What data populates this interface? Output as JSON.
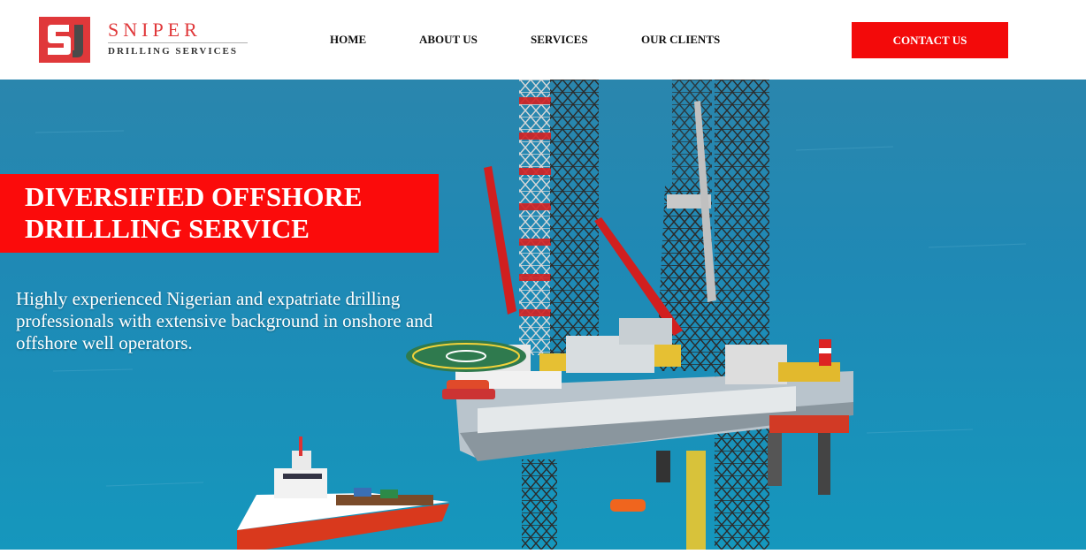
{
  "brand": {
    "name": "SNIPER",
    "tagline": "DRILLING SERVICES",
    "logo_icon": "sd-monogram-logo"
  },
  "nav": {
    "items": [
      {
        "label": "HOME"
      },
      {
        "label": "ABOUT US"
      },
      {
        "label": "SERVICES"
      },
      {
        "label": "OUR CLIENTS"
      }
    ],
    "contact_label": "CONTACT US"
  },
  "hero": {
    "headline_line1": "DIVERSIFIED OFFSHORE",
    "headline_line2": "DRILLLING SERVICE",
    "description": "Highly experienced Nigerian and expatriate drilling professionals with extensive background in onshore and offshore well operators.",
    "image": "offshore-drilling-rig-photo"
  },
  "colors": {
    "accent_red": "#f30a0a",
    "sea_blue": "#1b7fa8",
    "text_dark": "#111111"
  }
}
